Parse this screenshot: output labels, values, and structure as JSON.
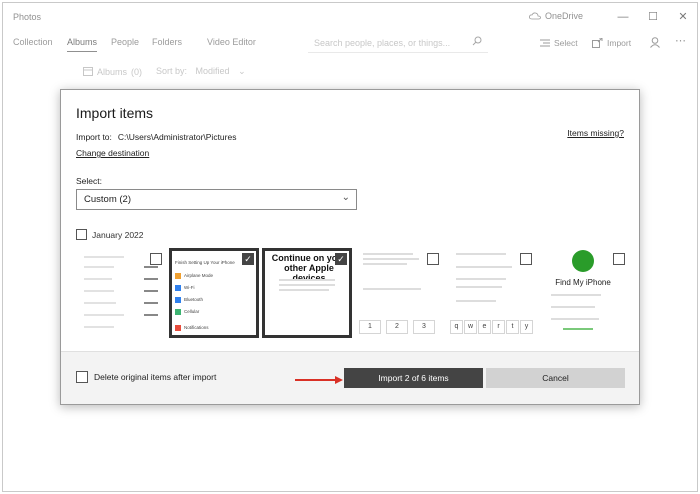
{
  "app": {
    "title": "Photos",
    "onedrive": "OneDrive",
    "controls": {
      "minimize": "—",
      "maximize": "☐",
      "close": "✕"
    }
  },
  "nav": {
    "tabs": [
      {
        "label": "Collection",
        "active": false
      },
      {
        "label": "Albums",
        "active": true
      },
      {
        "label": "People",
        "active": false
      },
      {
        "label": "Folders",
        "active": false
      },
      {
        "label": "Video Editor",
        "active": false
      }
    ],
    "search_placeholder": "Search people, places, or things...",
    "select_label": "Select",
    "import_label": "Import"
  },
  "sortbar": {
    "albums_label": "Albums",
    "albums_count": "(0)",
    "sort_label": "Sort by:",
    "sort_value": "Modified"
  },
  "dialog": {
    "title": "Import items",
    "import_to_label": "Import to:",
    "import_to_path": "C:\\Users\\Administrator\\Pictures",
    "change_destination": "Change destination",
    "items_missing": "Items missing?",
    "select_label": "Select:",
    "select_value": "Custom (2)",
    "month_label": "January 2022",
    "thumbnails": [
      {
        "selected": false
      },
      {
        "selected": true,
        "caption": "Finish Setting Up Your iPhone",
        "rows": [
          "Airplane Mode",
          "Wi-Fi",
          "Bluetooth",
          "Cellular",
          "Notifications"
        ]
      },
      {
        "selected": true,
        "caption": "Continue on your other Apple devices"
      },
      {
        "selected": false,
        "keys": [
          "1",
          "2",
          "3"
        ]
      },
      {
        "selected": false,
        "keys": [
          "q",
          "w",
          "e",
          "r",
          "t",
          "y"
        ]
      },
      {
        "selected": false,
        "caption": "Find My iPhone"
      }
    ],
    "delete_label": "Delete original items after import",
    "import_button": "Import 2 of 6 items",
    "cancel_button": "Cancel"
  },
  "colors": {
    "import_button_bg": "#444444",
    "cancel_button_bg": "#d2d2d2",
    "arrow": "#d93025",
    "findmy_green": "#2a9c2a"
  }
}
